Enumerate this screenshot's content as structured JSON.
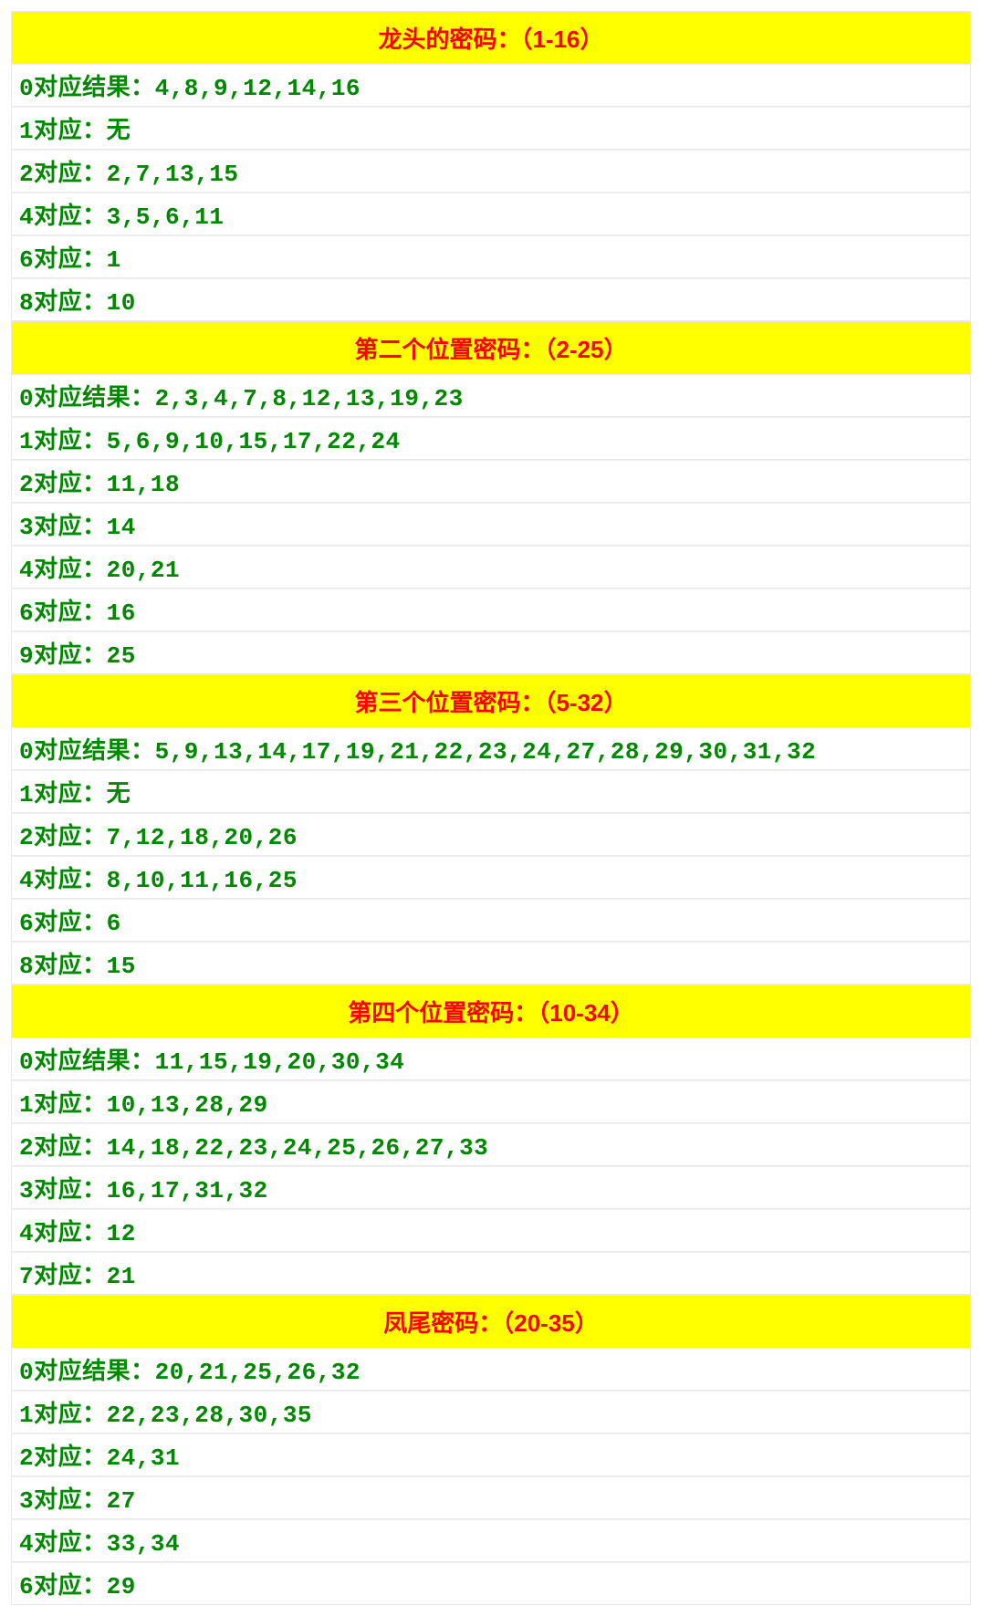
{
  "sections": [
    {
      "title": "龙头的密码：（1-16）",
      "rows": [
        "0对应结果：4,8,9,12,14,16",
        "1对应：无",
        "2对应：2,7,13,15",
        "4对应：3,5,6,11",
        "6对应：1",
        "8对应：10"
      ]
    },
    {
      "title": "第二个位置密码：（2-25）",
      "rows": [
        "0对应结果：2,3,4,7,8,12,13,19,23",
        "1对应：5,6,9,10,15,17,22,24",
        "2对应：11,18",
        "3对应：14",
        "4对应：20,21",
        "6对应：16",
        "9对应：25"
      ]
    },
    {
      "title": "第三个位置密码：（5-32）",
      "rows": [
        "0对应结果：5,9,13,14,17,19,21,22,23,24,27,28,29,30,31,32",
        "1对应：无",
        "2对应：7,12,18,20,26",
        "4对应：8,10,11,16,25",
        "6对应：6",
        "8对应：15"
      ]
    },
    {
      "title": "第四个位置密码：（10-34）",
      "rows": [
        "0对应结果：11,15,19,20,30,34",
        "1对应：10,13,28,29",
        "2对应：14,18,22,23,24,25,26,27,33",
        "3对应：16,17,31,32",
        "4对应：12",
        "7对应：21"
      ]
    },
    {
      "title": "凤尾密码：（20-35）",
      "rows": [
        "0对应结果：20,21,25,26,32",
        "1对应：22,23,28,30,35",
        "2对应：24,31",
        "3对应：27",
        "4对应：33,34",
        "6对应：29"
      ]
    }
  ]
}
